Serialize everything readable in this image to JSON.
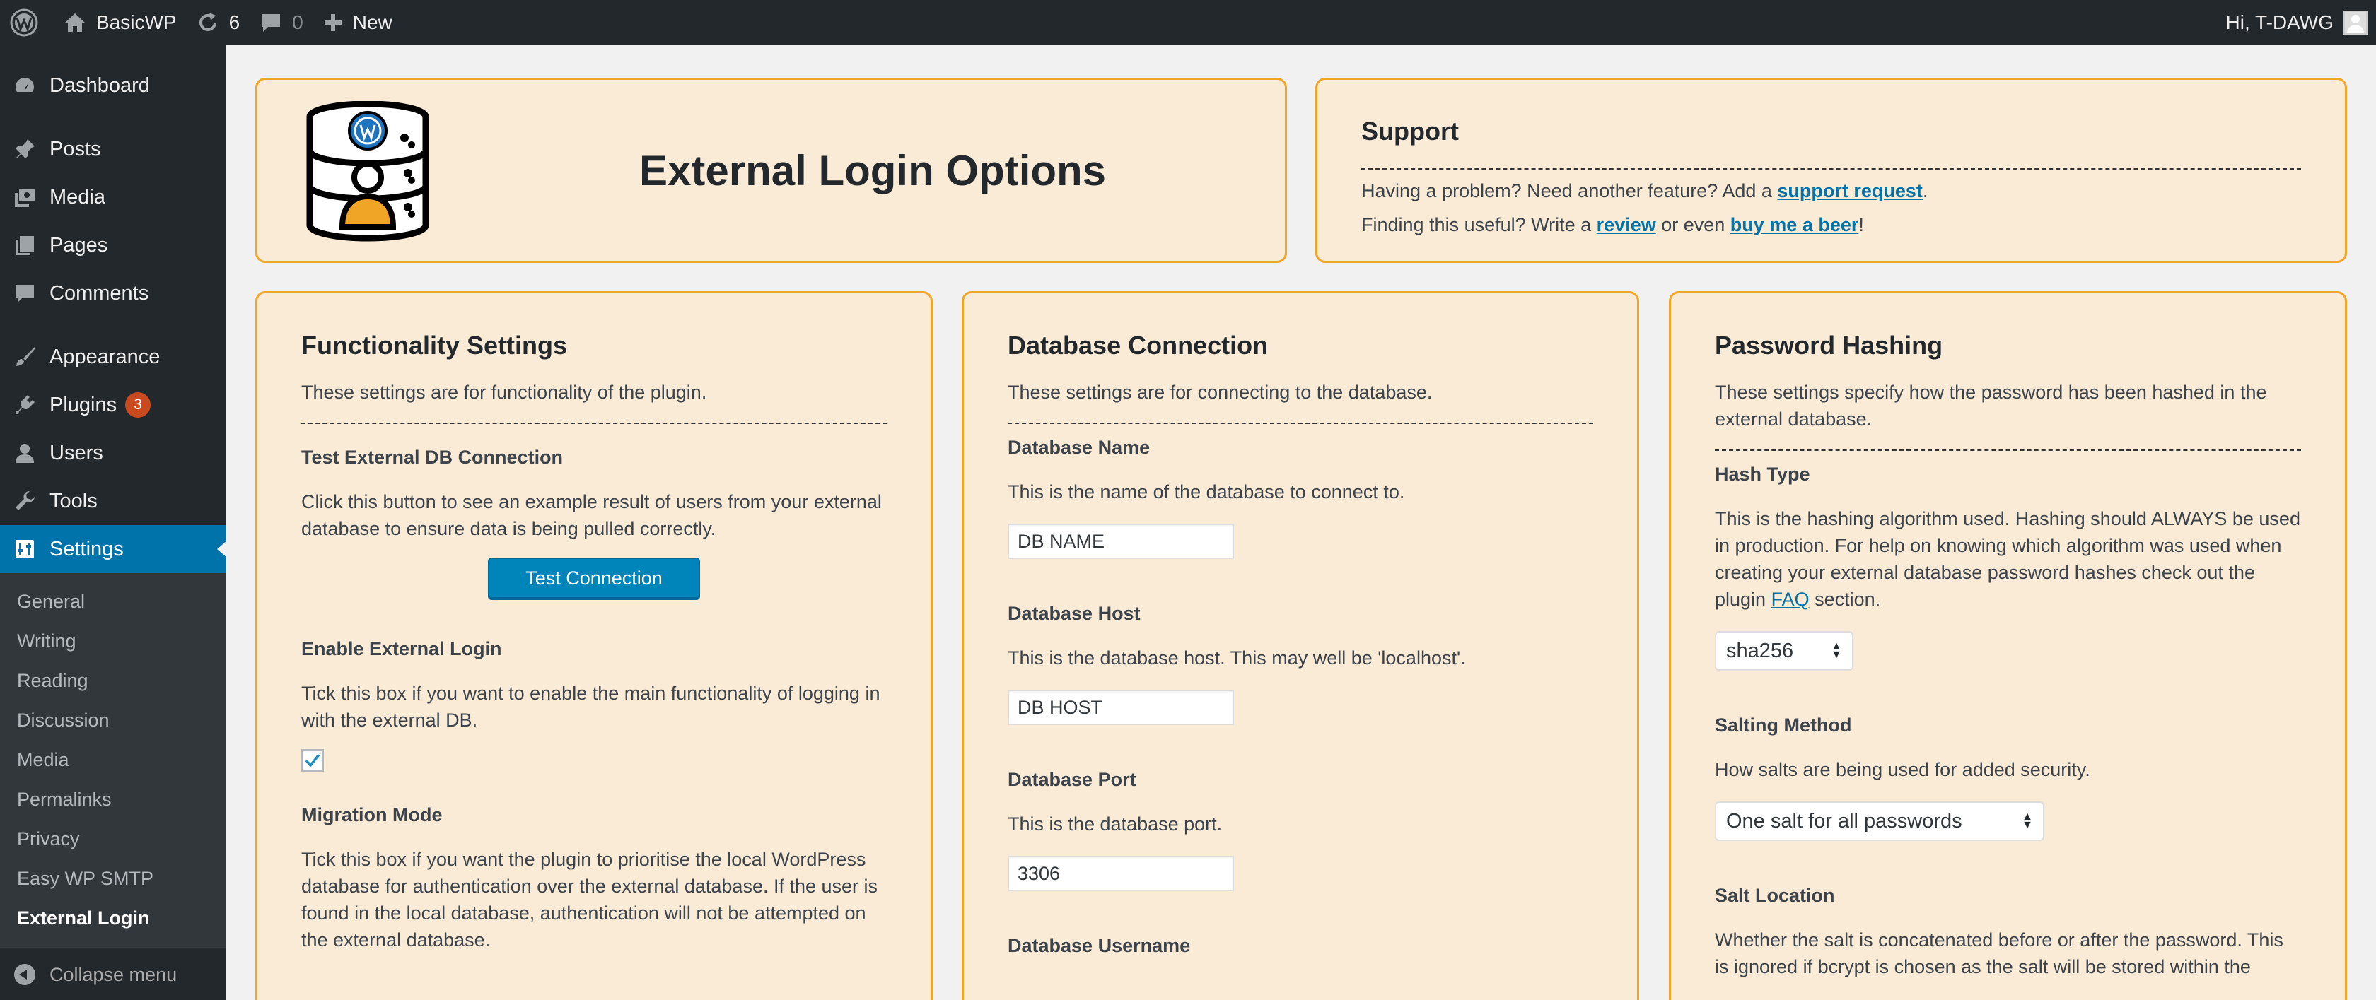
{
  "adminbar": {
    "site_name": "BasicWP",
    "updates_count": "6",
    "comments_count": "0",
    "new_label": "New",
    "greeting": "Hi, T-DAWG"
  },
  "sidebar": {
    "items": [
      {
        "label": "Dashboard",
        "icon": "dashboard-icon"
      },
      {
        "label": "Posts",
        "icon": "pin-icon"
      },
      {
        "label": "Media",
        "icon": "media-icon"
      },
      {
        "label": "Pages",
        "icon": "pages-icon"
      },
      {
        "label": "Comments",
        "icon": "comment-icon"
      },
      {
        "label": "Appearance",
        "icon": "brush-icon"
      },
      {
        "label": "Plugins",
        "icon": "plug-icon",
        "badge": "3"
      },
      {
        "label": "Users",
        "icon": "user-icon"
      },
      {
        "label": "Tools",
        "icon": "wrench-icon"
      },
      {
        "label": "Settings",
        "icon": "settings-icon"
      }
    ],
    "submenu": [
      "General",
      "Writing",
      "Reading",
      "Discussion",
      "Media",
      "Permalinks",
      "Privacy",
      "Easy WP SMTP",
      "External Login"
    ],
    "collapse_label": "Collapse menu"
  },
  "header": {
    "title": "External Login Options"
  },
  "support": {
    "title": "Support",
    "line1_prefix": "Having a problem? Need another feature? Add a ",
    "line1_link": "support request",
    "line1_suffix": ".",
    "line2_prefix": "Finding this useful? Write a ",
    "line2_link1": "review",
    "line2_mid": " or even ",
    "line2_link2": "buy me a beer",
    "line2_suffix": "!"
  },
  "functionality": {
    "title": "Functionality Settings",
    "intro": "These settings are for functionality of the plugin.",
    "test_heading": "Test External DB Connection",
    "test_desc": "Click this button to see an example result of users from your external database to ensure data is being pulled correctly.",
    "test_button": "Test Connection",
    "enable_heading": "Enable External Login",
    "enable_desc": "Tick this box if you want to enable the main functionality of logging in with the external DB.",
    "enable_checked": true,
    "migration_heading": "Migration Mode",
    "migration_desc": "Tick this box if you want the plugin to prioritise the local WordPress database for authentication over the external database. If the user is found in the local database, authentication will not be attempted on the external database."
  },
  "database": {
    "title": "Database Connection",
    "intro": "These settings are for connecting to the database.",
    "name_heading": "Database Name",
    "name_desc": "This is the name of the database to connect to.",
    "name_value": "DB NAME",
    "host_heading": "Database Host",
    "host_desc": "This is the database host. This may well be 'localhost'.",
    "host_value": "DB HOST",
    "port_heading": "Database Port",
    "port_desc": "This is the database port.",
    "port_value": "3306",
    "username_heading": "Database Username"
  },
  "hashing": {
    "title": "Password Hashing",
    "intro": "These settings specify how the password has been hashed in the external database.",
    "hash_heading": "Hash Type",
    "hash_desc_prefix": "This is the hashing algorithm used. Hashing should ALWAYS be used in production. For help on knowing which algorithm was used when creating your external database password hashes check out the plugin ",
    "hash_desc_link": "FAQ",
    "hash_desc_suffix": " section.",
    "hash_value": "sha256",
    "salting_heading": "Salting Method",
    "salting_desc": "How salts are being used for added security.",
    "salting_value": "One salt for all passwords",
    "location_heading": "Salt Location",
    "location_desc": "Whether the salt is concatenated before or after the password. This is ignored if bcrypt is chosen as the salt will be stored within the"
  },
  "colors": {
    "panel_bg": "#faebd7",
    "panel_border": "#f0a526",
    "accent": "#0073aa",
    "adminbar_bg": "#23282d"
  }
}
